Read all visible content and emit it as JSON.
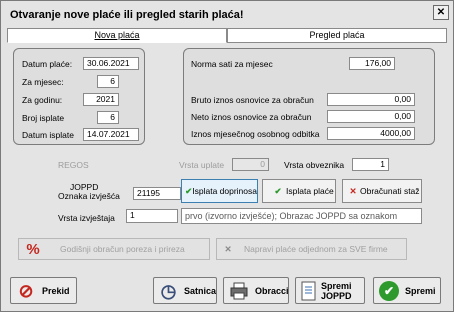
{
  "window": {
    "title": "Otvaranje nove plaće ili pregled starih plaća!",
    "close": "✕"
  },
  "tabs": [
    {
      "label": "Nova plaća"
    },
    {
      "label": "Pregled plaća"
    }
  ],
  "left_panel": {
    "datum_place_label": "Datum plaće:",
    "datum_place": "30.06.2021",
    "za_mjesec_label": "Za mjesec:",
    "za_mjesec": "6",
    "za_godinu_label": "Za godinu:",
    "za_godinu": "2021",
    "broj_isplate_label": "Broj isplate",
    "broj_isplate": "6",
    "datum_isplate_label": "Datum isplate",
    "datum_isplate": "14.07.2021"
  },
  "right_panel": {
    "norma_label": "Norma sati za mjesec",
    "norma": "176,00",
    "bruto_label": "Bruto iznos osnovice za obračun",
    "bruto": "0,00",
    "neto_label": "Neto iznos osnovice za obračun",
    "neto": "0,00",
    "odbitak_label": "Iznos mjesečnog osobnog odbitka",
    "odbitak": "4000,00"
  },
  "regos": {
    "label": "REGOS",
    "vrsta_uplate_label": "Vrsta uplate",
    "vrsta_uplate": "0",
    "vrsta_obveznika_label": "Vrsta obveznika",
    "vrsta_obveznika": "1"
  },
  "joppd": {
    "label": "JOPPD",
    "oznaka_label": "Oznaka izvješća",
    "oznaka": "21195",
    "vrsta_izvjestaja_label": "Vrsta izvještaja",
    "vrsta_izvjestaja": "1",
    "vrsta_izvjestaja_desc": "prvo (izvorno izvješće); Obrazac JOPPD sa oznakom"
  },
  "actions": {
    "isplata_doprinosa": "Isplata doprinosa",
    "isplata_place": "Isplata plaće",
    "obracunati_staz": "Obračunati staž",
    "godisnji_obracun": "Godišnji obračun poreza i prireza",
    "napravi_place": "Napravi plaće odjednom za SVE firme"
  },
  "bottom": {
    "prekid": "Prekid",
    "satnica": "Satnica",
    "obracci": "Obracci",
    "spremi_joppd": "Spremi JOPPD",
    "spremi": "Spremi"
  },
  "icons": {
    "percent": "%",
    "check": "✔",
    "cross": "✕",
    "stop": "⊘",
    "clock": "◷"
  },
  "colors": {
    "accent_green": "#2e9a2e",
    "accent_red": "#c4271f",
    "selected_border": "#3c7fb1"
  }
}
